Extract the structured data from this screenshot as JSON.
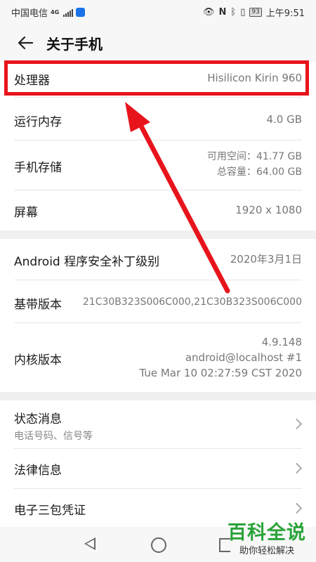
{
  "status_bar": {
    "carrier": "中国电信",
    "network": "4G",
    "battery": "93",
    "time": "上午9:51"
  },
  "header": {
    "title": "关于手机"
  },
  "rows": [
    {
      "label": "处理器",
      "value": "Hisilicon Kirin 960"
    },
    {
      "label": "运行内存",
      "value": "4.0 GB"
    },
    {
      "label": "手机存储",
      "value_line1": "可用空间：41.77  GB",
      "value_line2": "总容量：64.00  GB"
    },
    {
      "label": "屏幕",
      "value": "1920 x 1080"
    },
    {
      "label": "Android 程序安全补丁级别",
      "value": "2020年3月1日"
    },
    {
      "label": "基带版本",
      "value": "21C30B323S006C000,21C30B323S006C000"
    },
    {
      "label": "内核版本",
      "value_line1": "4.9.148",
      "value_line2": "android@localhost #1",
      "value_line3": "Tue Mar 10 02:27:59 CST 2020"
    },
    {
      "label": "状态消息",
      "sub": "电话号码、信号等"
    },
    {
      "label": "法律信息"
    },
    {
      "label": "电子三包凭证"
    }
  ],
  "watermark": {
    "main": "百科全说",
    "sub": "助你轻松解决"
  },
  "colors": {
    "highlight": "#e8141c",
    "watermark": "#2aa33a"
  }
}
